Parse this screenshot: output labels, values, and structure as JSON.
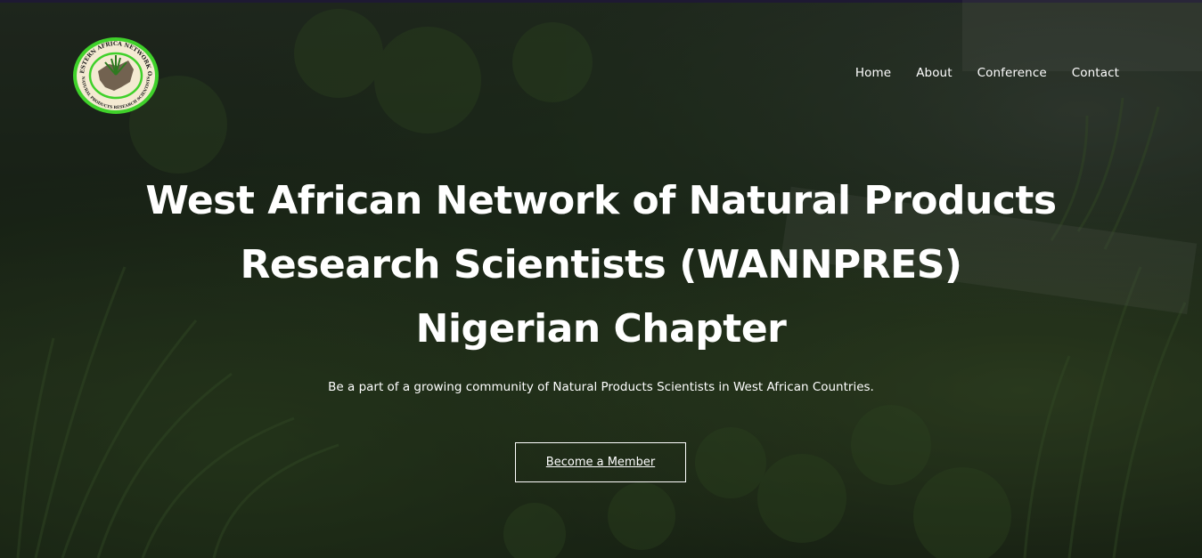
{
  "logo": {
    "ring_text_top": "WESTERN AFRICA NETWORK OF",
    "ring_text_bottom": "NATURAL PRODUCTS RESEARCH SCIENTISTS",
    "ring_color": "#3fd12a",
    "inner_color": "#f4ead2"
  },
  "nav": {
    "items": [
      {
        "label": "Home"
      },
      {
        "label": "About"
      },
      {
        "label": "Conference"
      },
      {
        "label": "Contact"
      }
    ]
  },
  "hero": {
    "title_line1": "West African Network of Natural Products",
    "title_line2": "Research Scientists (WANNPRES)",
    "title_line3": "Nigerian Chapter",
    "subtitle": "Be a part of a growing community of Natural Products Scientists in West African Countries.",
    "cta_label": "Become a Member"
  },
  "colors": {
    "text": "#ffffff",
    "top_accent": "#2a1f4a"
  }
}
